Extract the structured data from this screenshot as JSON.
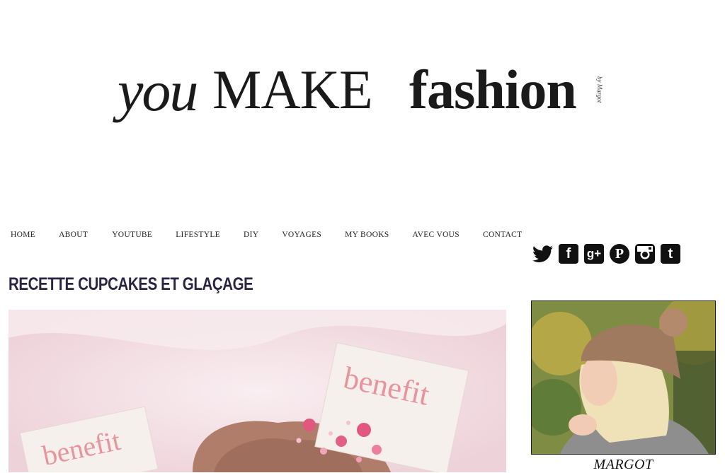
{
  "logo": {
    "you": "you",
    "make": "MAKE",
    "fashion": "fashion",
    "byline": "by Margot"
  },
  "nav": [
    "HOME",
    "ABOUT",
    "YOUTUBE",
    "LIFESTYLE",
    "DIY",
    "VOYAGES",
    "MY BOOKS",
    "AVEC VOUS",
    "CONTACT"
  ],
  "social": [
    {
      "name": "twitter-icon"
    },
    {
      "name": "facebook-icon",
      "glyph": "f"
    },
    {
      "name": "google-plus-icon",
      "glyph": "g+"
    },
    {
      "name": "pinterest-icon",
      "glyph": "P"
    },
    {
      "name": "instagram-icon"
    },
    {
      "name": "tumblr-icon",
      "glyph": "t"
    }
  ],
  "post": {
    "title": "RECETTE CUPCAKES ET GLAÇAGE",
    "image_labels": [
      "benefit",
      "benefit"
    ]
  },
  "sidebar": {
    "caption": "MARGOT"
  },
  "colors": {
    "title": "#2b2340",
    "background": "#ffffff",
    "text": "#111111"
  }
}
